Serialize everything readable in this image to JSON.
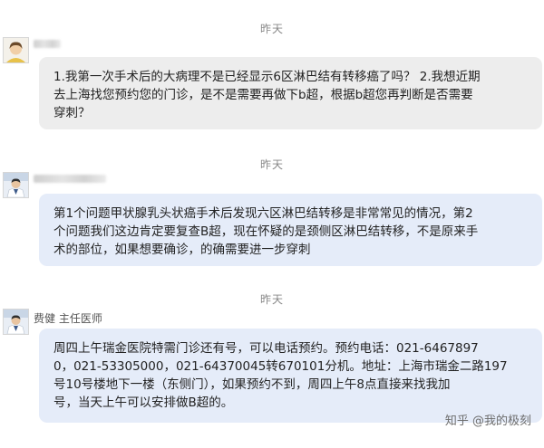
{
  "messages": [
    {
      "timestamp": "昨天",
      "sender": "",
      "sender_redacted": true,
      "bubble_color": "#ededed",
      "lines": [
        "1.我第一次手术后的大病理不是已经显示6区淋巴结有转移癌了吗？ 2.我想近期",
        "去上海找您预约您的门诊，是不是需要再做下b超，根据b超您再判断是否需要",
        "穿刺？"
      ]
    },
    {
      "timestamp": "昨天",
      "sender": "",
      "sender_redacted": true,
      "bubble_color": "#e5ecf9",
      "lines": [
        "第1个问题甲状腺乳头状癌手术后发现六区淋巴结转移是非常常见的情况，第2",
        "个问题我们这边肯定要复查B超，现在怀疑的是颈侧区淋巴结转移，不是原来手",
        "术的部位，如果想要确诊，的确需要进一步穿刺"
      ]
    },
    {
      "timestamp": "昨天",
      "sender": "费健 主任医师",
      "sender_redacted": false,
      "bubble_color": "#e5ecf9",
      "lines": [
        "周四上午瑞金医院特需门诊还有号，可以电话预约。预约电话：021-6467897",
        "0，021-53305000，021-64370045转670101分机。地址：上海市瑞金二路197",
        "号10号楼地下一楼（东侧门），如果预约不到，周四上午8点直接来找我加",
        "号，当天上午可以安排做B超的。"
      ]
    }
  ],
  "watermark": "知乎 @我的极刻"
}
